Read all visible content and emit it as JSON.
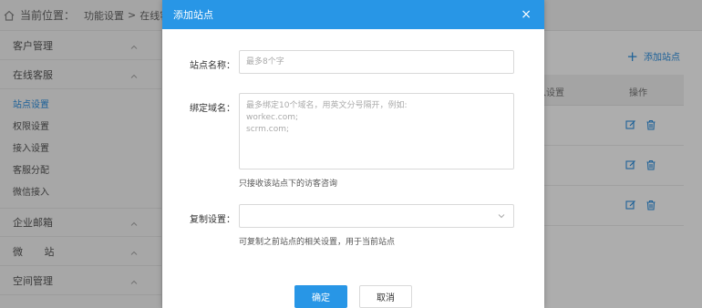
{
  "breadcrumb": {
    "label": "当前位置：",
    "items": [
      "功能设置",
      "在线客"
    ],
    "separator": ">"
  },
  "sidebar": {
    "groups": [
      {
        "label": "客户管理"
      },
      {
        "label": "在线客服"
      },
      {
        "label": "企业邮箱"
      },
      {
        "label": "微 站"
      },
      {
        "label": "空间管理"
      }
    ],
    "sub_items": [
      {
        "label": "站点设置",
        "active": true
      },
      {
        "label": "权限设置",
        "active": false
      },
      {
        "label": "接入设置",
        "active": false
      },
      {
        "label": "客服分配",
        "active": false
      },
      {
        "label": "微信接入",
        "active": false
      }
    ]
  },
  "content": {
    "add_site_label": "添加站点",
    "table": {
      "columns": [
        "入设置",
        "操作"
      ]
    }
  },
  "modal": {
    "title": "添加站点",
    "close_label": "×",
    "site_name": {
      "label": "站点名称：",
      "placeholder": "最多8个字",
      "value": ""
    },
    "bind_domain": {
      "label": "绑定域名：",
      "placeholder": "最多绑定10个域名，用英文分号隔开，例如:\nworkec.com;\nscrm.com;",
      "value": "",
      "hint": "只接收该站点下的访客咨询"
    },
    "copy_settings": {
      "label": "复制设置：",
      "value": "",
      "hint": "可复制之前站点的相关设置，用于当前站点"
    },
    "confirm_label": "确定",
    "cancel_label": "取消"
  },
  "colors": {
    "accent": "#2896e6",
    "link": "#2b8fe0",
    "overlay": "rgba(0,0,0,0.32)"
  }
}
